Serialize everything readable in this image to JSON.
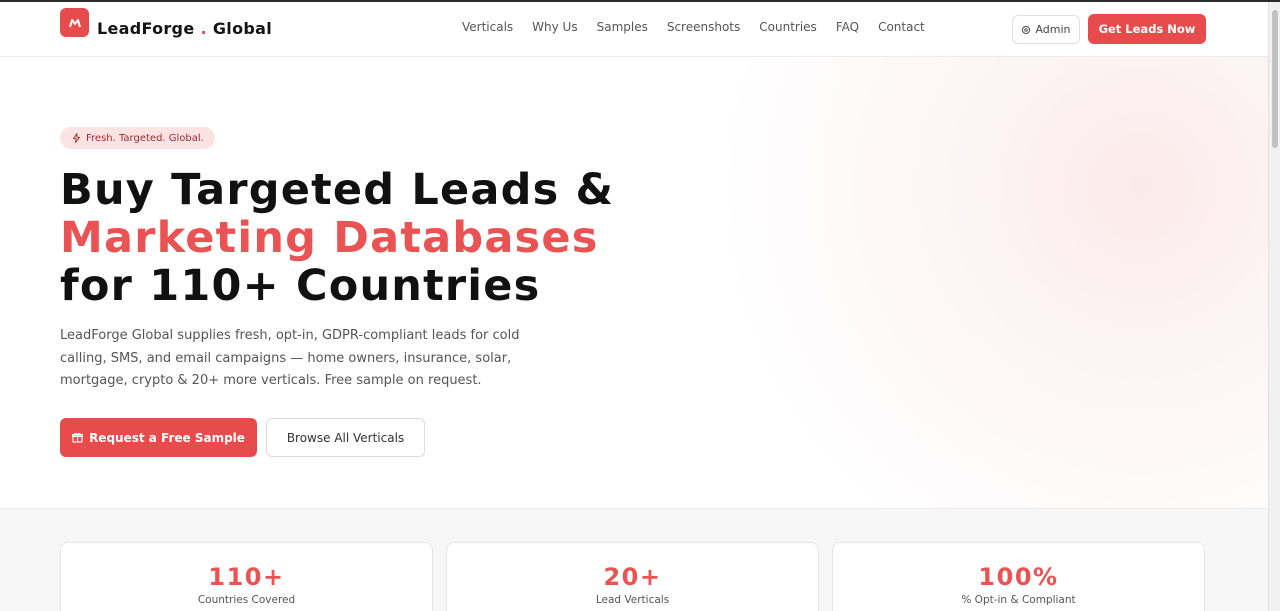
{
  "header": {
    "logo_mark": "M",
    "logo_name": "LeadForge",
    "logo_dot": ".",
    "logo_suffix": "Global",
    "nav": [
      "Verticals",
      "Why Us",
      "Samples",
      "Screenshots",
      "Countries",
      "FAQ",
      "Contact"
    ],
    "admin_label": "Admin",
    "admin_icon": "gear-icon",
    "cta_label": "Get Leads Now"
  },
  "hero": {
    "badge_icon": "lightning-icon",
    "badge_text": "Fresh. Targeted. Global.",
    "headline_1": "Buy Targeted Leads &",
    "headline_2": "Marketing Databases",
    "headline_3": "for 110+ Countries",
    "description": "LeadForge Global supplies fresh, opt-in, GDPR-compliant leads for cold calling, SMS, and email campaigns — home owners, insurance, solar, mortgage, crypto & 20+ more verticals. Free sample on request.",
    "primary_icon": "gift-icon",
    "primary_label": "Request a Free Sample",
    "secondary_label": "Browse All Verticals"
  },
  "stats": [
    {
      "value": "110+",
      "label": "Countries Covered"
    },
    {
      "value": "20+",
      "label": "Lead Verticals"
    },
    {
      "value": "100%",
      "label": "% Opt-in & Compliant"
    }
  ],
  "colors": {
    "accent": "#e84b4b",
    "headline_accent": "#ea5353",
    "text": "#111111"
  }
}
